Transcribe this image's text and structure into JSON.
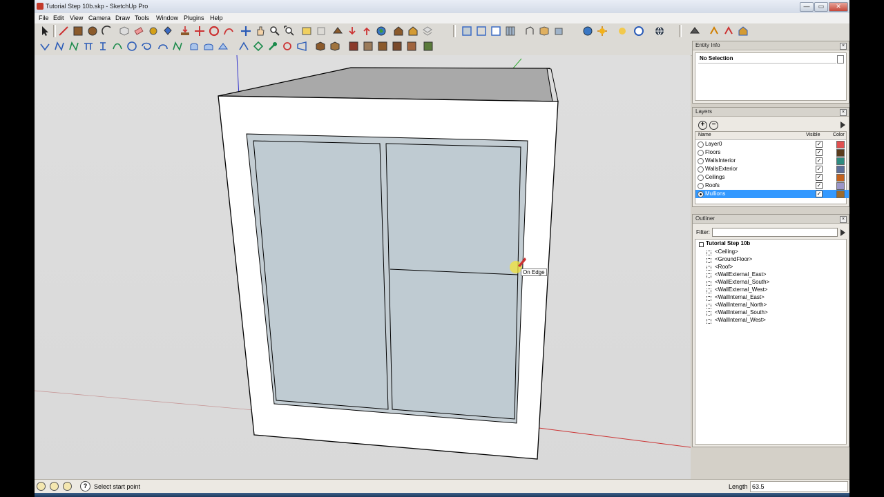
{
  "window": {
    "title": "Tutorial Step 10b.skp - SketchUp Pro",
    "minimize": "—",
    "maximize": "▭",
    "close": "✕"
  },
  "menu": [
    "File",
    "Edit",
    "View",
    "Camera",
    "Draw",
    "Tools",
    "Window",
    "Plugins",
    "Help"
  ],
  "viewport": {
    "inference_label": "On Edge"
  },
  "entity_info": {
    "title": "Entity Info",
    "value": "No Selection"
  },
  "layers": {
    "title": "Layers",
    "col_name": "Name",
    "col_visible": "Visible",
    "col_color": "Color",
    "rows": [
      {
        "name": "Layer0",
        "color": "#e05050",
        "active": false
      },
      {
        "name": "Floors",
        "color": "#5a3b1d",
        "active": false
      },
      {
        "name": "WallsInterior",
        "color": "#2e8b80",
        "active": false
      },
      {
        "name": "WallsExterior",
        "color": "#5d6f9a",
        "active": false
      },
      {
        "name": "Ceilings",
        "color": "#c4621d",
        "active": false
      },
      {
        "name": "Roofs",
        "color": "#9b96c8",
        "active": false
      },
      {
        "name": "Mullions",
        "color": "#9b6a2c",
        "active": true
      }
    ]
  },
  "outliner": {
    "title": "Outliner",
    "filter_label": "Filter:",
    "root": "Tutorial Step 10b",
    "items": [
      "<Ceiling>",
      "<GroundFloor>",
      "<Roof>",
      "<WallExternal_East>",
      "<WallExternal_South>",
      "<WallExternal_West>",
      "<WallInternal_East>",
      "<WallInternal_North>",
      "<WallInternal_South>",
      "<WallInternal_West>"
    ]
  },
  "status": {
    "message": "Select start point",
    "measurement_label": "Length",
    "measurement_value": "63.5"
  },
  "colors": {
    "accent_selection": "#3399ff",
    "glass": "#c3cdd3",
    "wall": "#ffffff",
    "roof_top": "#a9a9a9"
  }
}
